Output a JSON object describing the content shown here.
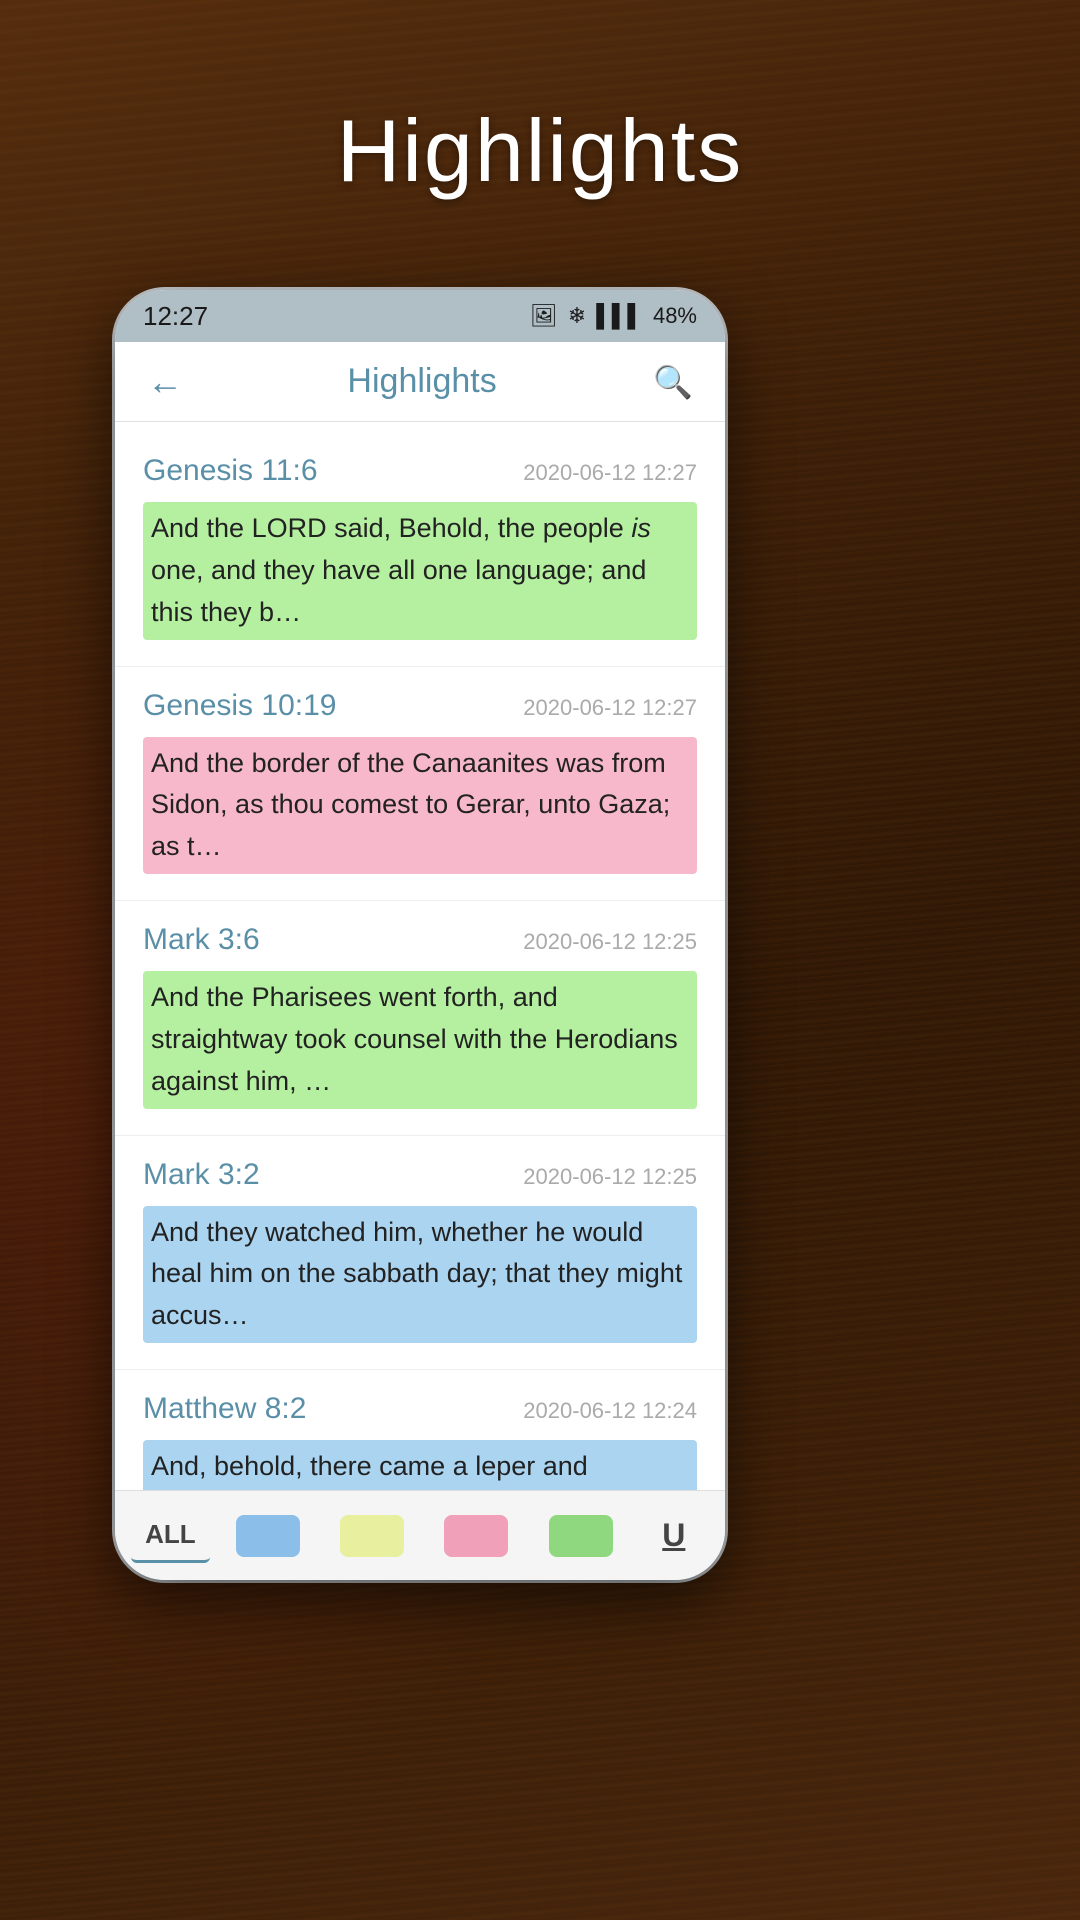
{
  "page": {
    "bg_title": "Highlights",
    "app_bar": {
      "title": "Highlights",
      "back_label": "←",
      "search_label": "🔍"
    },
    "status_bar": {
      "time": "12:27",
      "battery": "48%",
      "signal": "▌▌▌",
      "image_icon": "🖼",
      "bluetooth_icon": "❄"
    },
    "highlights": [
      {
        "ref": "Genesis 11:6",
        "date": "2020-06-12 12:27",
        "text": "And the LORD said, Behold, the people is one, and they have all one language; and this they b…",
        "highlight_color": "green",
        "italic_word": "is"
      },
      {
        "ref": "Genesis 10:19",
        "date": "2020-06-12 12:27",
        "text": "And the border of the Canaanites was from Sidon, as thou comest to Gerar, unto Gaza; as t…",
        "highlight_color": "pink"
      },
      {
        "ref": "Mark 3:6",
        "date": "2020-06-12 12:25",
        "text": "And the Pharisees went forth, and straightway took counsel with the Herodians against him, …",
        "highlight_color": "green"
      },
      {
        "ref": "Mark 3:2",
        "date": "2020-06-12 12:25",
        "text": "And they watched him, whether he would heal him on the sabbath day; that they might accus…",
        "highlight_color": "blue"
      },
      {
        "ref": "Matthew 8:2",
        "date": "2020-06-12 12:24",
        "text": "And, behold, there came a leper and worshipped him, saying, Lord, if thou wilt, thou canst make …",
        "highlight_color": "blue"
      }
    ],
    "bottom_bar": {
      "all_label": "ALL",
      "underline_label": "U",
      "tabs": [
        {
          "id": "all",
          "label": "ALL",
          "active": true
        },
        {
          "id": "blue",
          "color": "blue"
        },
        {
          "id": "yellow",
          "color": "yellow"
        },
        {
          "id": "pink",
          "color": "pink"
        },
        {
          "id": "green",
          "color": "green"
        },
        {
          "id": "underline",
          "label": "U"
        }
      ]
    }
  }
}
